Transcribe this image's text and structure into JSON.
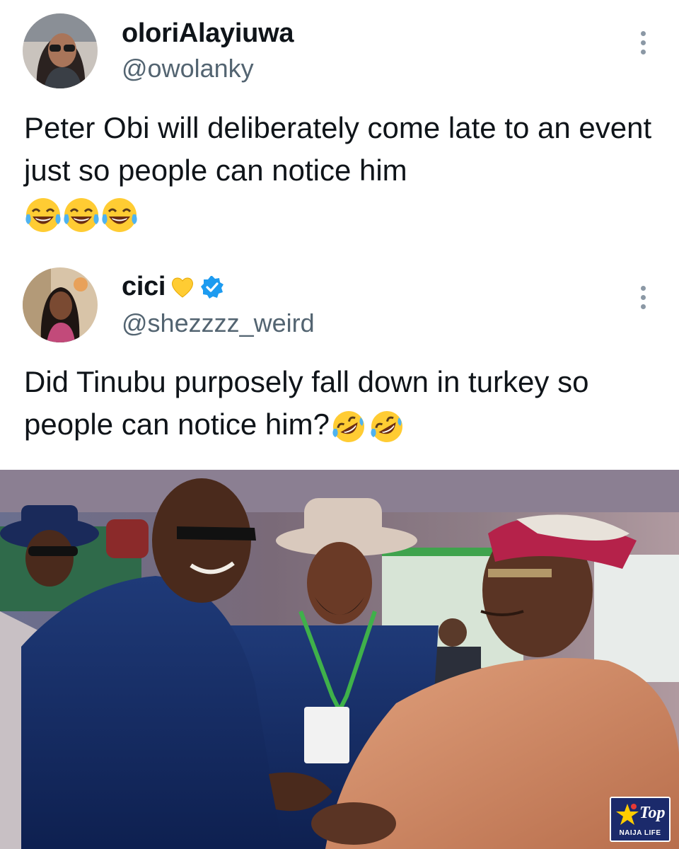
{
  "tweets": [
    {
      "display_name": "oloriAlayiuwa",
      "handle": "@owolanky",
      "text": "Peter Obi will deliberately come late to an event just so people can notice him",
      "emojis": [
        "joy",
        "joy",
        "joy"
      ]
    },
    {
      "display_name": "cici",
      "handle": "@shezzzz_weird",
      "text": "Did Tinubu purposely fall down in turkey so people can notice him?",
      "emojis": [
        "rofl",
        "rofl"
      ],
      "badges": [
        "yellow-heart-icon",
        "verified-badge-icon"
      ]
    }
  ],
  "watermark": {
    "brand": "Top",
    "subtitle": "NAIJA LIFE"
  },
  "colors": {
    "text": "#0f1419",
    "handle": "#536471",
    "verified": "#1d9bf0",
    "watermark_bg": "#1b2a6b"
  }
}
